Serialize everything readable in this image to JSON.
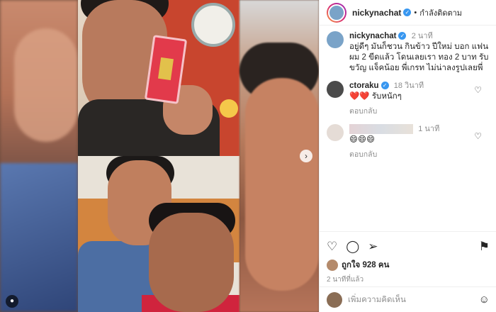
{
  "post": {
    "username": "nickynachat",
    "follow_status": "กำลังติดตาม",
    "caption_user": "nickynachat",
    "caption_time": "2 นาที",
    "caption_text": "อยู่ดีๆ มันก็ชวน กินข้าว ปีใหม่ บอก แฟน ผม 2 ขีดแล้ว โดนเลยเรา ทอง 2 บาท รับขวัญ แจ็คน้อย พี่เกรท ไม่น่าลงรูปเลยพี่"
  },
  "comments": [
    {
      "user": "ctoraku",
      "time": "18 วินาที",
      "text": "รับหนักๆ",
      "emoji": "❤️❤️",
      "reply_label": "ตอบกลับ"
    },
    {
      "user": "",
      "time": "1 นาที",
      "text": "",
      "emoji": "😄😄😄",
      "reply_label": "ตอบกลับ"
    }
  ],
  "actions": {
    "likes_text": "ถูกใจ 928 คน",
    "time_ago": "2 นาทีที่แล้ว"
  },
  "add_comment": {
    "placeholder": "เพิ่มความคิดเห็น"
  },
  "icons": {
    "verified": "✓",
    "next": "›",
    "heart": "♡",
    "comment": "◯",
    "share": "➢",
    "save": "⚑",
    "smile": "☺",
    "user": "●"
  },
  "colors": {
    "verified": "#3897f0",
    "muted": "#8e8e8e",
    "border": "#efefef"
  }
}
